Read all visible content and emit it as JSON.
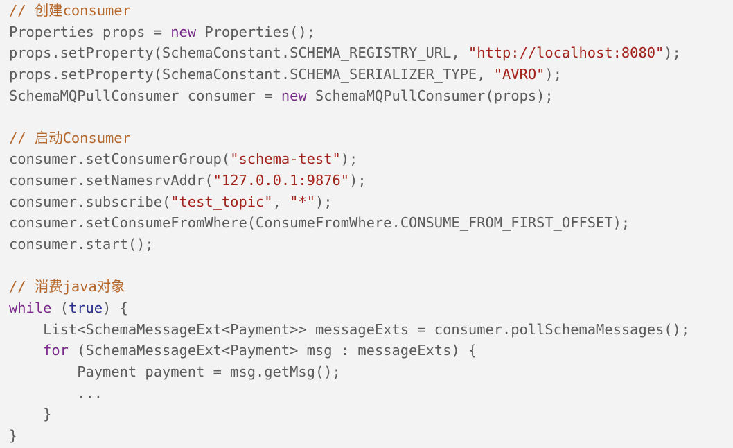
{
  "colors": {
    "background": "#f3f3f3",
    "plain": "#5c5c5c",
    "comment": "#b5672b",
    "keyword": "#7b2a8c",
    "literal": "#2b2f8e",
    "string": "#a3231c"
  },
  "code_lines": [
    [
      [
        "comment",
        "// 创建consumer"
      ]
    ],
    [
      [
        "plain",
        "Properties props = "
      ],
      [
        "kw",
        "new"
      ],
      [
        "plain",
        " Properties();"
      ]
    ],
    [
      [
        "plain",
        "props.setProperty(SchemaConstant.SCHEMA_REGISTRY_URL, "
      ],
      [
        "str",
        "\"http://localhost:8080\""
      ],
      [
        "plain",
        ");"
      ]
    ],
    [
      [
        "plain",
        "props.setProperty(SchemaConstant.SCHEMA_SERIALIZER_TYPE, "
      ],
      [
        "str",
        "\"AVRO\""
      ],
      [
        "plain",
        ");"
      ]
    ],
    [
      [
        "plain",
        "SchemaMQPullConsumer consumer = "
      ],
      [
        "kw",
        "new"
      ],
      [
        "plain",
        " SchemaMQPullConsumer(props);"
      ]
    ],
    [],
    [
      [
        "comment",
        "// 启动Consumer"
      ]
    ],
    [
      [
        "plain",
        "consumer.setConsumerGroup("
      ],
      [
        "str",
        "\"schema-test\""
      ],
      [
        "plain",
        ");"
      ]
    ],
    [
      [
        "plain",
        "consumer.setNamesrvAddr("
      ],
      [
        "str",
        "\"127.0.0.1:9876\""
      ],
      [
        "plain",
        ");"
      ]
    ],
    [
      [
        "plain",
        "consumer.subscribe("
      ],
      [
        "str",
        "\"test_topic\""
      ],
      [
        "plain",
        ", "
      ],
      [
        "str",
        "\"*\""
      ],
      [
        "plain",
        ");"
      ]
    ],
    [
      [
        "plain",
        "consumer.setConsumeFromWhere(ConsumeFromWhere.CONSUME_FROM_FIRST_OFFSET);"
      ]
    ],
    [
      [
        "plain",
        "consumer.start();"
      ]
    ],
    [],
    [
      [
        "comment",
        "// 消费java对象"
      ]
    ],
    [
      [
        "kw",
        "while"
      ],
      [
        "plain",
        " ("
      ],
      [
        "lit",
        "true"
      ],
      [
        "plain",
        ") {"
      ]
    ],
    [
      [
        "plain",
        "    List<SchemaMessageExt<Payment>> messageExts = consumer.pollSchemaMessages();"
      ]
    ],
    [
      [
        "plain",
        "    "
      ],
      [
        "kw",
        "for"
      ],
      [
        "plain",
        " (SchemaMessageExt<Payment> msg : messageExts) {"
      ]
    ],
    [
      [
        "plain",
        "        Payment payment = msg.getMsg();"
      ]
    ],
    [
      [
        "plain",
        "        ..."
      ]
    ],
    [
      [
        "plain",
        "    }"
      ]
    ],
    [
      [
        "plain",
        "}"
      ]
    ]
  ]
}
